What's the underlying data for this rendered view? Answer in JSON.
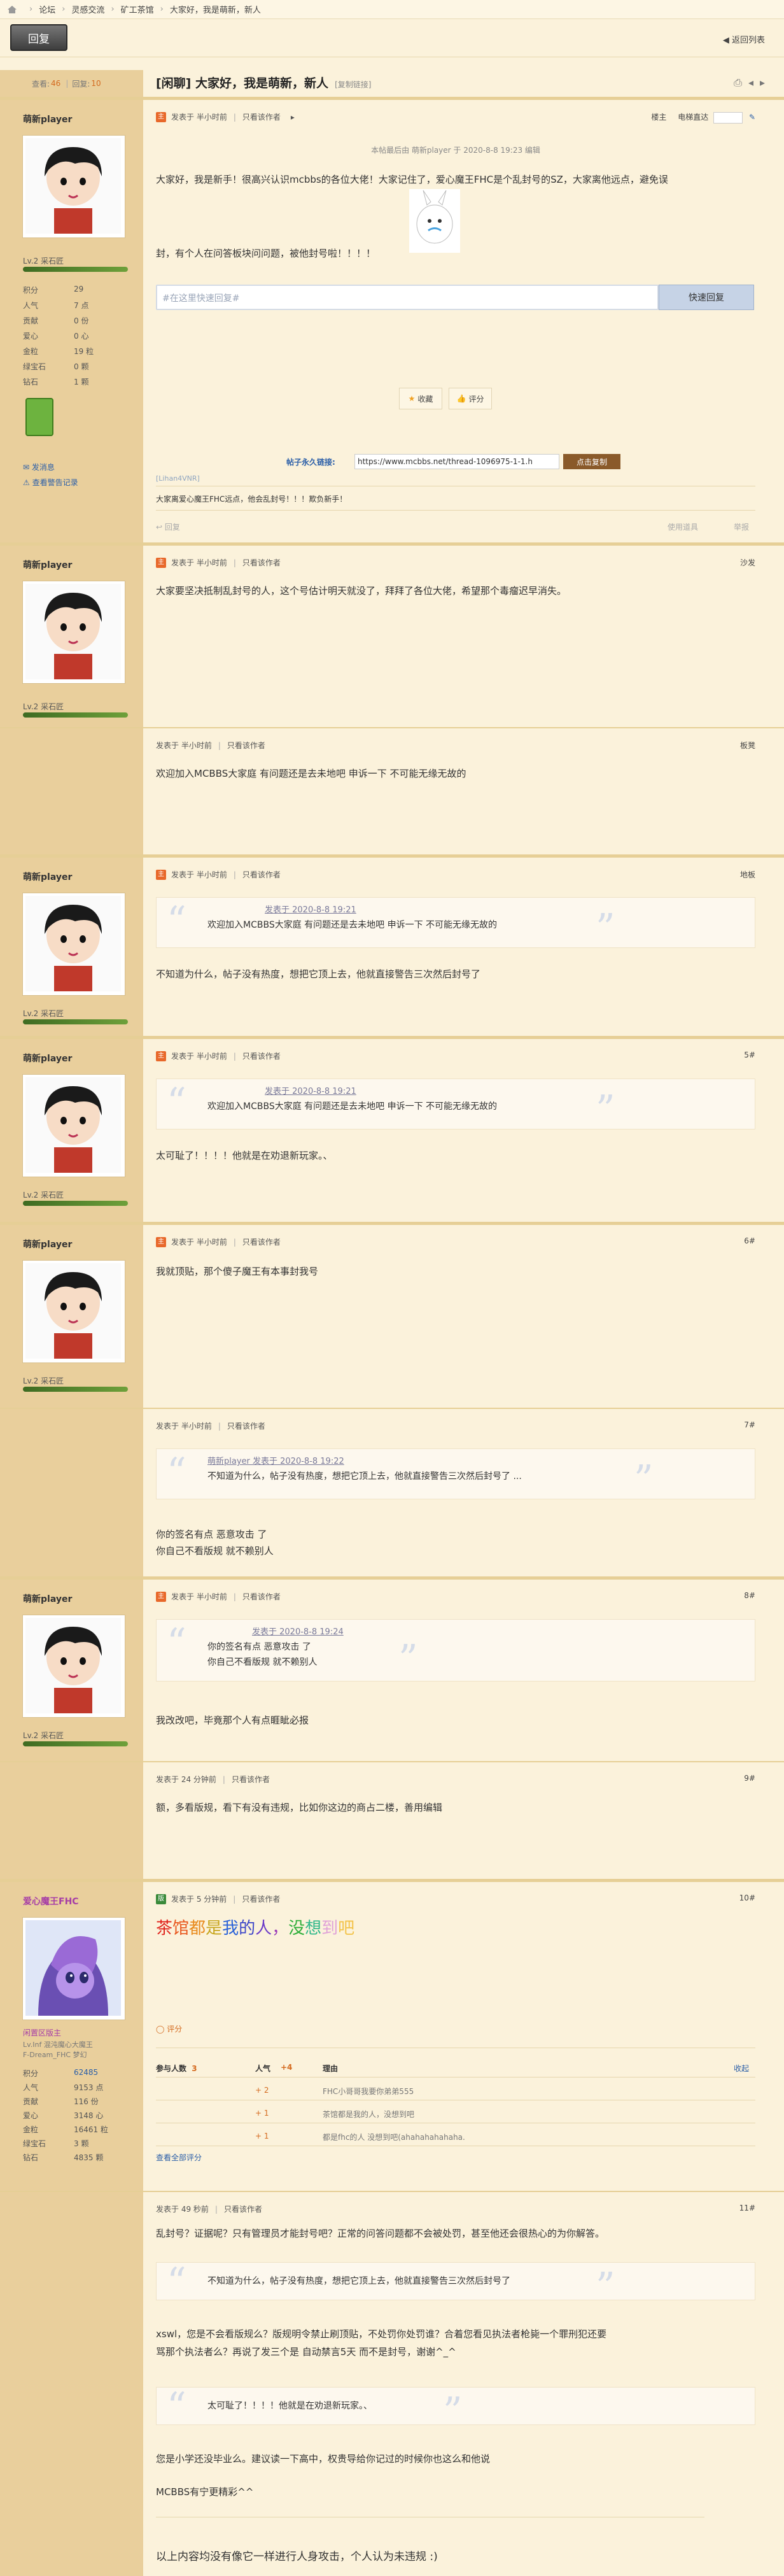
{
  "breadcrumb": [
    "论坛",
    "灵感交流",
    "矿工茶馆",
    "大家好，我是萌新，新人"
  ],
  "toolbar": {
    "reply": "回复",
    "back": "返回列表"
  },
  "thread": {
    "views_label": "查看:",
    "views": "46",
    "replies_label": "回复:",
    "replies": "10",
    "title": "[闲聊] 大家好，我是萌新，新人",
    "copy_link": "[复制链接]"
  },
  "posts": [
    {
      "user": "萌新player",
      "level": "Lv.2 采石匠",
      "stats": [
        [
          "积分",
          "29"
        ],
        [
          "人气",
          "7 点"
        ],
        [
          "贡献",
          "0 份"
        ],
        [
          "爱心",
          "0 心"
        ],
        [
          "金粒",
          "19 粒"
        ],
        [
          "绿宝石",
          "0 颗"
        ],
        [
          "钻石",
          "1 颗"
        ]
      ],
      "links": [
        "发消息",
        "查看警告记录"
      ],
      "meta": [
        "发表于 半小时前",
        "只看该作者"
      ],
      "floor": "楼主",
      "floor_extra": "电梯直达",
      "edit_note": "本帖最后由 萌新player 于 2020-8-8 19:23 编辑",
      "text1": "大家好，我是新手！很高兴认识mcbbs的各位大佬！大家记住了，爱心魔王FHC是个乱封号的SZ，大家离他远点，避免误",
      "text2": "封，有个人在问答板块问问题，被他封号啦！！！！",
      "quick_reply_placeholder": "#在这里快速回复#",
      "quick_reply_btn": "快速回复",
      "fav": "收藏",
      "rate": "评分",
      "perm_label": "帖子永久链接:",
      "perm_url": "https://www.mcbbs.net/thread-1096975-1-1.h",
      "perm_copy": "点击复制",
      "sig_link": "[Lihan4VNR]",
      "footnote": "大家离爱心魔王FHC远点，他会乱封号！！！欺负新手！",
      "reply_label": "回复",
      "report": "举报",
      "use_tool": "使用道具"
    },
    {
      "user": "萌新player",
      "level": "Lv.2 采石匠",
      "meta": [
        "发表于 半小时前",
        "只看该作者"
      ],
      "floor": "沙发",
      "text": "大家要坚决抵制乱封号的人，这个号估计明天就没了，拜拜了各位大佬，希望那个毒瘤迟早消失。"
    },
    {
      "meta": [
        "发表于 半小时前",
        "只看该作者"
      ],
      "floor": "板凳",
      "text": "欢迎加入MCBBS大家庭  有问题还是去未地吧  申诉一下 不可能无缘无故的"
    },
    {
      "user": "萌新player",
      "level": "Lv.2 采石匠",
      "meta": [
        "发表于 半小时前",
        "只看该作者"
      ],
      "floor": "地板",
      "quote_author": "发表于 2020-8-8 19:21",
      "quote_text": "欢迎加入MCBBS大家庭  有问题还是去未地吧  申诉一下 不可能无缘无故的",
      "text": "不知道为什么，帖子没有热度，想把它顶上去，他就直接警告三次然后封号了"
    },
    {
      "user": "萌新player",
      "level": "Lv.2 采石匠",
      "meta": [
        "发表于 半小时前",
        "只看该作者"
      ],
      "floor": "5#",
      "quote_author": "发表于 2020-8-8 19:21",
      "quote_text": "欢迎加入MCBBS大家庭  有问题还是去未地吧  申诉一下 不可能无缘无故的",
      "text": "太可耻了！！！！他就是在劝退新玩家。、"
    },
    {
      "user": "萌新player",
      "level": "Lv.2 采石匠",
      "meta": [
        "发表于 半小时前",
        "只看该作者"
      ],
      "floor": "6#",
      "text": "我就顶贴，那个傻子魔王有本事封我号"
    },
    {
      "meta": [
        "发表于 半小时前",
        "只看该作者"
      ],
      "floor": "7#",
      "quote_author": "萌新player 发表于 2020-8-8 19:22",
      "quote_text": "不知道为什么，帖子没有热度，想把它顶上去，他就直接警告三次然后封号了 ...",
      "text1": "你的签名有点 恶意攻击 了",
      "text2": "你自己不看版规 就不赖别人"
    },
    {
      "user": "萌新player",
      "level": "Lv.2 采石匠",
      "meta": [
        "发表于 半小时前",
        "只看该作者"
      ],
      "floor": "8#",
      "quote_author": "发表于 2020-8-8 19:24",
      "quote_text1": "你的签名有点 恶意攻击 了",
      "quote_text2": "你自己不看版规 就不赖别人",
      "text": "我改改吧，毕竟那个人有点睚眦必报"
    },
    {
      "meta": [
        "发表于 24 分钟前",
        "只看该作者"
      ],
      "floor": "9#",
      "text": "额，多看版规，看下有没有违规，比如你这边的商占二楼，善用编辑"
    },
    {
      "user": "爱心魔王FHC",
      "group": "闲置区版主",
      "group_desc": "Lv.Inf 混沌魔心大魔王\nF-Dream_FHC 梦幻",
      "stats": [
        [
          "积分",
          "62485"
        ],
        [
          "人气",
          "9153 点"
        ],
        [
          "贡献",
          "116 份"
        ],
        [
          "爱心",
          "3148 心"
        ],
        [
          "金粒",
          "16461 粒"
        ],
        [
          "绿宝石",
          "3 颗"
        ],
        [
          "钻石",
          "4835 颗"
        ]
      ],
      "meta": [
        "发表于 5 分钟前",
        "只看该作者"
      ],
      "floor": "10#",
      "rainbow": [
        "茶",
        "馆",
        "都",
        "是",
        "我",
        "的",
        "人",
        "，",
        "没",
        "想",
        "到",
        "吧"
      ],
      "rate_title": "评分",
      "rate_head": [
        "参与人数",
        "3",
        "人气",
        "+4",
        "理由",
        "收起"
      ],
      "rate_rows": [
        [
          "+ 2",
          "FHC小哥哥我要你弟弟555"
        ],
        [
          "+ 1",
          "茶馆都是我的人，没想到吧"
        ],
        [
          "+ 1",
          "都是fhc的人 没想到吧(ahahahahahaha."
        ]
      ],
      "rate_all": "查看全部评分"
    },
    {
      "meta": [
        "发表于 49 秒前",
        "只看该作者"
      ],
      "floor": "11#",
      "text1": "乱封号？证据呢？只有管理员才能封号吧？正常的问答问题都不会被处罚，甚至他还会很热心的为你解答。",
      "quote1": "不知道为什么，帖子没有热度，想把它顶上去，他就直接警告三次然后封号了",
      "text2": "xswl，您是不会看版规么？版规明令禁止刷顶贴，不处罚你处罚谁？合着您看见执法者枪毙一个罪刑犯还要",
      "text3": "骂那个执法者么？再说了发三个是 自动禁言5天 而不是封号，谢谢^_^",
      "quote2": "太可耻了！！！！他就是在劝退新玩家。、",
      "text4": "您是小学还没毕业么。建议读一下高中，权贵导给你记过的时候你也这么和他说",
      "text5": "MCBBS有宁更精彩^^",
      "text6": "以上内容均没有像它一样进行人身攻击，个人认为未违规 :)"
    }
  ]
}
